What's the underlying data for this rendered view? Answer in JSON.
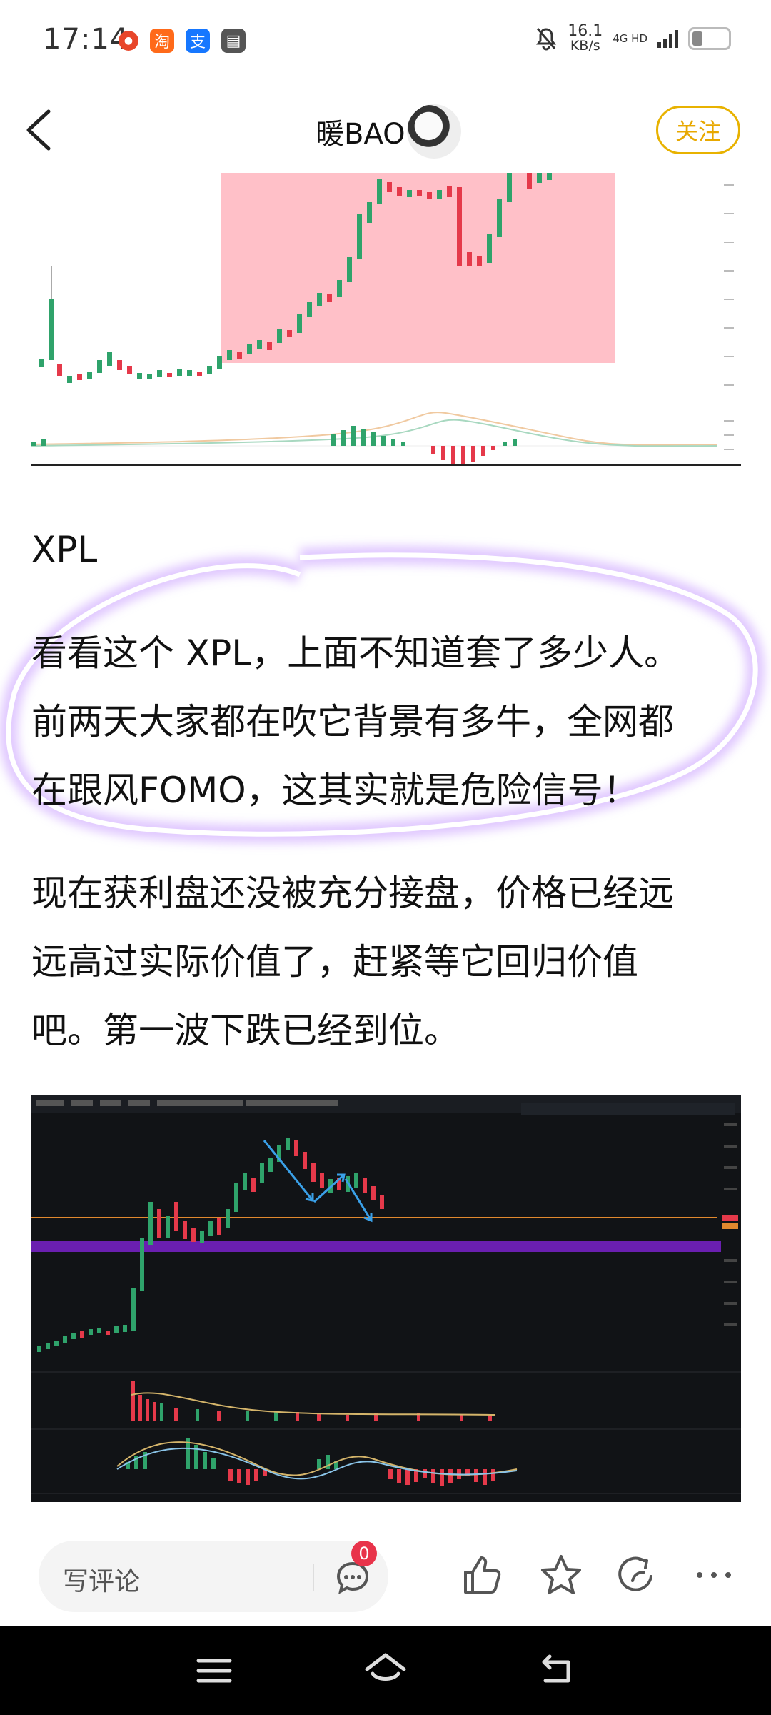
{
  "status_bar": {
    "time": "17:14",
    "network_speed_value": "16.1",
    "network_speed_unit": "KB/s",
    "network_type": "4G HD",
    "app_icons": [
      "weibo-icon",
      "taobao-icon",
      "alipay-icon",
      "calendar-icon"
    ],
    "app_glyphs": [
      "●",
      "淘",
      "支",
      "▤"
    ],
    "app_colors": [
      "#e8462a",
      "#ff6a1a",
      "#1677ff",
      "#555555"
    ]
  },
  "header": {
    "title": "暖BAO",
    "follow_label": "关注"
  },
  "article": {
    "section_title": "XPL",
    "highlighted_lines": [
      "看看这个 XPL，上面不知道套了多少人。",
      "前两天大家都在吹它背景有多牛，全网都",
      "在跟风FOMO，这其实就是危险信号！"
    ],
    "body_lines": [
      "现在获利盘还没被充分接盘，价格已经远",
      "远高过实际价值了，赶紧等它回归价值",
      "吧。第一波下跌已经到位。"
    ]
  },
  "bottom_bar": {
    "comment_placeholder": "写评论",
    "comment_count": "0"
  },
  "colors": {
    "follow_accent": "#e8b200",
    "highlight_ring": "#b277ff",
    "chart1_zone": "#ffc0c8",
    "chart2_band": "#6a1fb0",
    "up_candle": "#2fa36b",
    "down_candle": "#e5394a"
  }
}
